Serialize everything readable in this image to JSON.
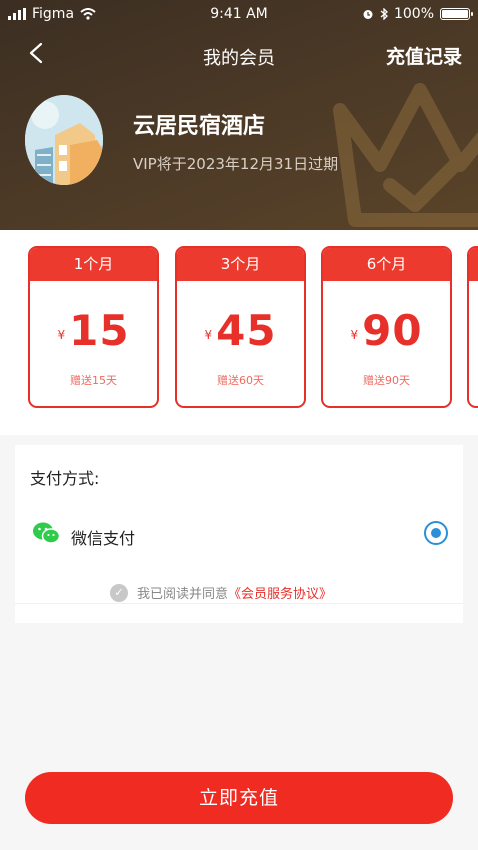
{
  "status_bar": {
    "carrier": "Figma",
    "time": "9:41 AM",
    "battery": "100%"
  },
  "nav": {
    "title": "我的会员",
    "action": "充值记录"
  },
  "profile": {
    "name": "云居民宿酒店",
    "vip_expire": "VIP将于2023年12月31日过期"
  },
  "plans": [
    {
      "duration": "1个月",
      "currency": "¥",
      "price": "15",
      "gift": "赠送15天"
    },
    {
      "duration": "3个月",
      "currency": "¥",
      "price": "45",
      "gift": "赠送60天"
    },
    {
      "duration": "6个月",
      "currency": "¥",
      "price": "90",
      "gift": "赠送90天"
    }
  ],
  "payment": {
    "label": "支付方式:",
    "method": "微信支付",
    "agree_text": "我已阅读并同意",
    "agree_link": "《会员服务协议》"
  },
  "button": {
    "label": "立即充值"
  },
  "colors": {
    "accent": "#ec3b2e",
    "header_bg": "#4a3826",
    "radio": "#2a8fd8",
    "wechat": "#2ecc4a"
  }
}
